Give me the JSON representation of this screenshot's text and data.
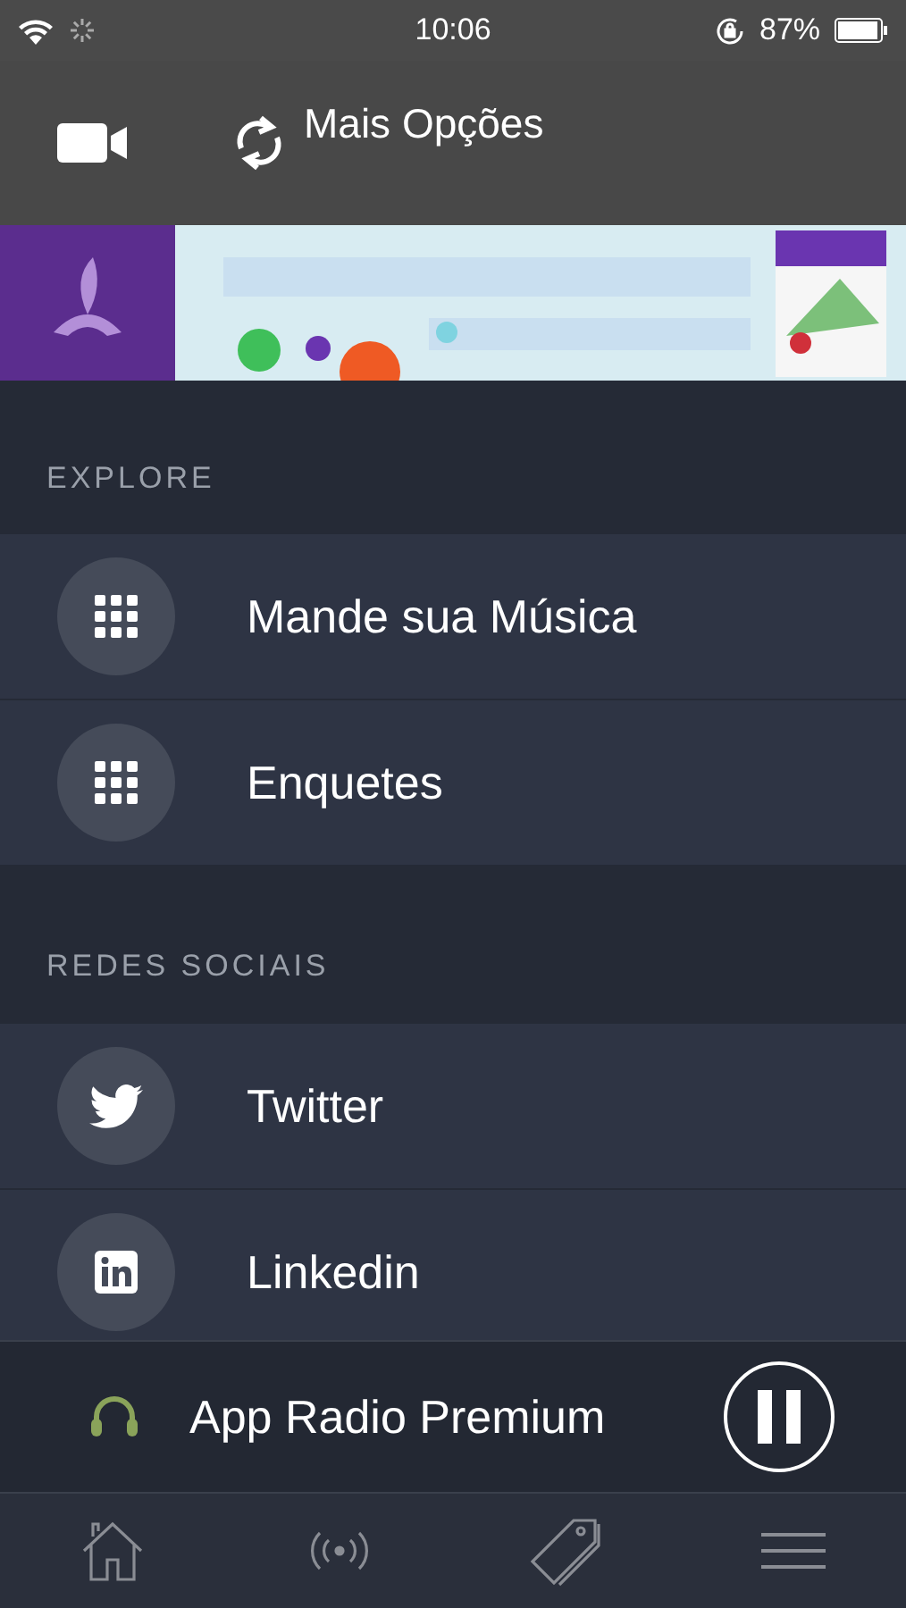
{
  "status_bar": {
    "time": "10:06",
    "battery": "87%"
  },
  "header": {
    "title": "Mais Opções"
  },
  "sections": [
    {
      "title": "EXPLORE",
      "items": [
        {
          "label": "Mande sua Música",
          "kind": "grid"
        },
        {
          "label": "Enquetes",
          "kind": "grid"
        }
      ]
    },
    {
      "title": "REDES SOCIAIS",
      "items": [
        {
          "label": "Twitter",
          "kind": "bird"
        },
        {
          "label": "Linkedin",
          "kind": "square"
        }
      ]
    }
  ],
  "player": {
    "station": "App Radio Premium",
    "playing": true
  },
  "tabs": [
    {
      "kind": "home",
      "selected": false
    },
    {
      "kind": "broadcast",
      "selected": false
    },
    {
      "kind": "tag",
      "selected": false
    },
    {
      "kind": "menu",
      "selected": false
    }
  ]
}
